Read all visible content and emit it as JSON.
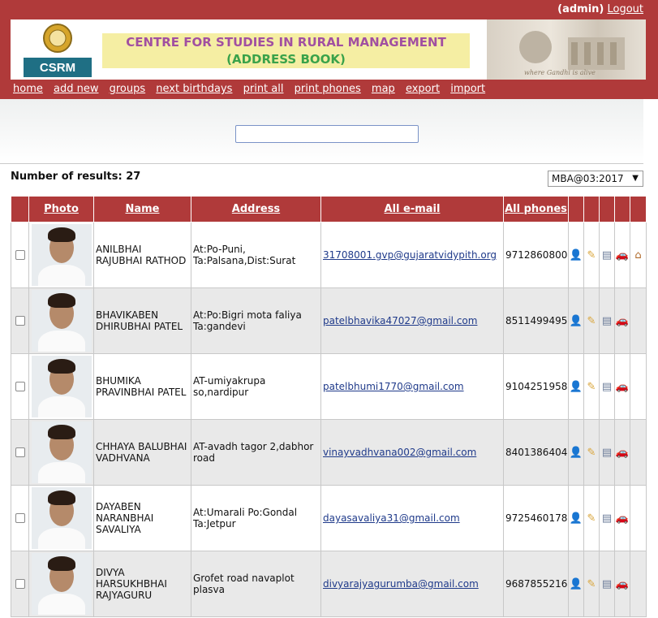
{
  "topbar": {
    "user": "(admin)",
    "logout": "Logout"
  },
  "header": {
    "logo_text": "CSRM",
    "title_line1": "CENTRE FOR STUDIES IN RURAL MANAGEMENT",
    "title_line2": "(ADDRESS BOOK)",
    "photo_caption": "where Gandhi is alive"
  },
  "nav": [
    "home",
    "add new",
    "groups",
    "next birthdays",
    "print all",
    "print phones",
    "map",
    "export",
    "import"
  ],
  "search": {
    "value": "",
    "placeholder": ""
  },
  "results": {
    "label": "Number of results: 27",
    "group_selected": "MBA@03:2017"
  },
  "table": {
    "headers": {
      "photo": "Photo",
      "name": "Name",
      "address": "Address",
      "email": "All e-mail",
      "phones": "All phones"
    },
    "rows": [
      {
        "name": "ANILBHAI RAJUBHAI RATHOD",
        "address": "At:Po-Puni, Ta:Palsana,Dist:Surat",
        "email": "31708001.gvp@gujaratvidypith.org",
        "phone": "9712860800",
        "home": true
      },
      {
        "name": "BHAVIKABEN DHIRUBHAI PATEL",
        "address": "At:Po:Bigri mota faliya Ta:gandevi",
        "email": "patelbhavika47027@gmail.com",
        "phone": "8511499495",
        "home": false
      },
      {
        "name": "BHUMIKA PRAVINBHAI PATEL",
        "address": "AT-umiyakrupa so,nardipur",
        "email": "patelbhumi1770@gmail.com",
        "phone": "9104251958",
        "home": false
      },
      {
        "name": "CHHAYA BALUBHAI VADHVANA",
        "address": "AT-avadh tagor 2,dabhor road",
        "email": "vinayvadhvana002@gmail.com",
        "phone": "8401386404",
        "home": false
      },
      {
        "name": "DAYABEN NARANBHAI SAVALIYA",
        "address": "At:Umarali Po:Gondal Ta:Jetpur",
        "email": "dayasavaliya31@gmail.com",
        "phone": "9725460178",
        "home": false
      },
      {
        "name": "DIVYA HARSUKHBHAI RAJYAGURU",
        "address": "Grofet road navaplot plasva",
        "email": "divyarajyagurumba@gmail.com",
        "phone": "9687855216",
        "home": false
      }
    ]
  },
  "icons": {
    "details": "person-icon",
    "edit": "pencil-icon",
    "vcard": "vcard-icon",
    "route": "car-icon",
    "home": "home-icon"
  },
  "colors": {
    "brand_red": "#b03a3a",
    "banner_bg": "#f5eea3",
    "title_purple": "#a14fa1",
    "title_green": "#39a24a"
  }
}
